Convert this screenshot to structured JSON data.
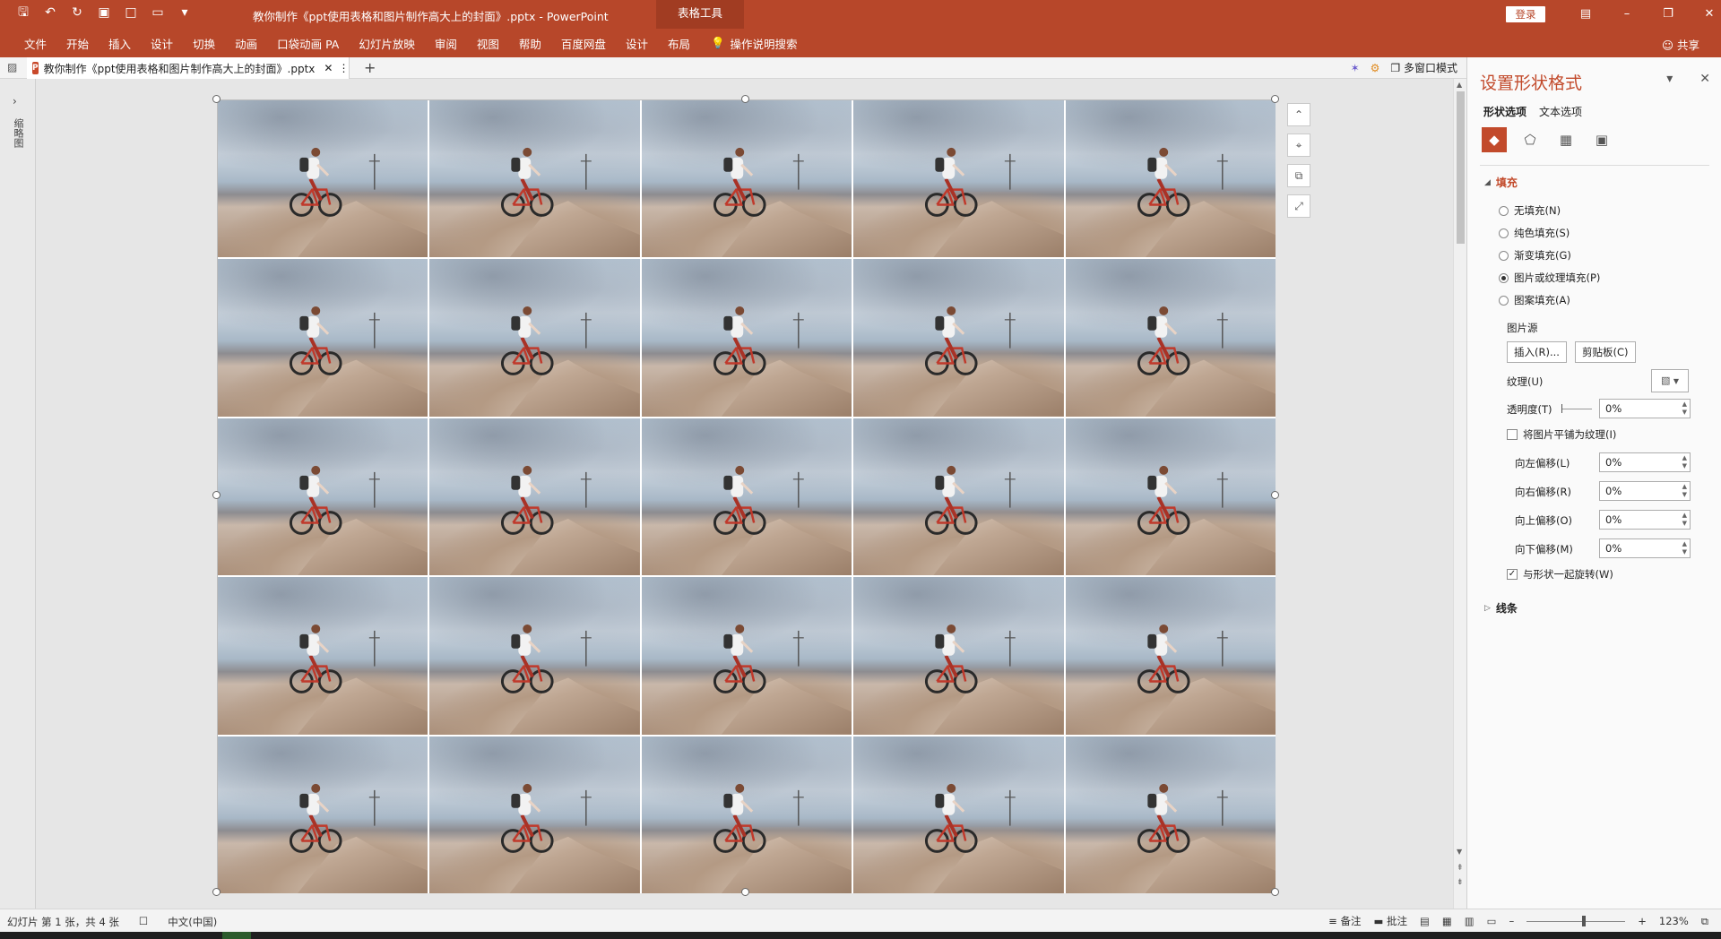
{
  "titlebar": {
    "title": "教你制作《ppt使用表格和图片制作高大上的封面》.pptx  -  PowerPoint",
    "contextual_tab": "表格工具",
    "login": "登录",
    "qat_icons": [
      "save-icon",
      "undo-icon",
      "redo-icon",
      "slideshow-icon",
      "new-icon",
      "open-icon",
      "customize-icon"
    ],
    "window_controls": [
      "ribbon-display-icon",
      "minimize-icon",
      "restore-icon",
      "close-icon"
    ]
  },
  "ribbon": {
    "tabs": [
      "文件",
      "开始",
      "插入",
      "设计",
      "切换",
      "动画",
      "口袋动画 PA",
      "幻灯片放映",
      "审阅",
      "视图",
      "帮助",
      "百度网盘",
      "设计",
      "布局"
    ],
    "tell_me": "操作说明搜索",
    "share": "共享"
  },
  "docbar": {
    "tab_label": "教你制作《ppt使用表格和图片制作高大上的封面》.pptx",
    "multiwindow": "多窗口模式"
  },
  "leftstrip": {
    "label": "缩略图"
  },
  "slide": {
    "rows": 5,
    "cols": 5,
    "cell_image": "cyclist-on-mountain-photo"
  },
  "pane": {
    "title": "设置形状格式",
    "subtabs": [
      "形状选项",
      "文本选项"
    ],
    "icon_tabs": [
      "fill-line-icon",
      "effects-icon",
      "size-properties-icon",
      "picture-icon"
    ],
    "fill": {
      "header": "填充",
      "options": [
        {
          "label": "无填充(N)",
          "selected": false
        },
        {
          "label": "纯色填充(S)",
          "selected": false
        },
        {
          "label": "渐变填充(G)",
          "selected": false
        },
        {
          "label": "图片或纹理填充(P)",
          "selected": true
        },
        {
          "label": "图案填充(A)",
          "selected": false
        }
      ],
      "picture_source": "图片源",
      "insert_btn": "插入(R)...",
      "clipboard_btn": "剪贴板(C)",
      "texture": "纹理(U)",
      "transparency": "透明度(T)",
      "transparency_value": "0%",
      "tile": "将图片平铺为纹理(I)",
      "offset_left": "向左偏移(L)",
      "offset_left_value": "0%",
      "offset_right": "向右偏移(R)",
      "offset_right_value": "0%",
      "offset_top": "向上偏移(O)",
      "offset_top_value": "0%",
      "offset_bottom": "向下偏移(M)",
      "offset_bottom_value": "0%",
      "rotate_with_shape": "与形状一起旋转(W)",
      "rotate_checked": true,
      "tile_checked": false
    },
    "line": {
      "header": "线条"
    }
  },
  "status": {
    "slide_info": "幻灯片 第 1 张，共 4 张",
    "language": "中文(中国)",
    "notes": "备注",
    "comments": "批注",
    "zoom": "123%"
  },
  "colors": {
    "accent": "#b7472a",
    "pane_title": "#c24a2b"
  }
}
